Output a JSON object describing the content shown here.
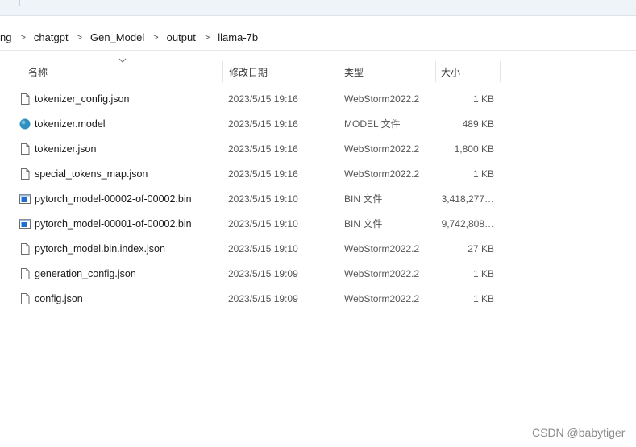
{
  "breadcrumb": [
    "ng",
    "chatgpt",
    "Gen_Model",
    "output",
    "llama-7b"
  ],
  "columns": {
    "name": "名称",
    "date": "修改日期",
    "type": "类型",
    "size": "大小"
  },
  "files": [
    {
      "name": "tokenizer_config.json",
      "date": "2023/5/15 19:16",
      "type": "WebStorm2022.2",
      "size": "1 KB",
      "icon": "json-file-icon"
    },
    {
      "name": "tokenizer.model",
      "date": "2023/5/15 19:16",
      "type": "MODEL 文件",
      "size": "489 KB",
      "icon": "model-file-icon"
    },
    {
      "name": "tokenizer.json",
      "date": "2023/5/15 19:16",
      "type": "WebStorm2022.2",
      "size": "1,800 KB",
      "icon": "json-file-icon"
    },
    {
      "name": "special_tokens_map.json",
      "date": "2023/5/15 19:16",
      "type": "WebStorm2022.2",
      "size": "1 KB",
      "icon": "json-file-icon"
    },
    {
      "name": "pytorch_model-00002-of-00002.bin",
      "date": "2023/5/15 19:10",
      "type": "BIN 文件",
      "size": "3,418,277…",
      "icon": "bin-file-icon"
    },
    {
      "name": "pytorch_model-00001-of-00002.bin",
      "date": "2023/5/15 19:10",
      "type": "BIN 文件",
      "size": "9,742,808…",
      "icon": "bin-file-icon"
    },
    {
      "name": "pytorch_model.bin.index.json",
      "date": "2023/5/15 19:10",
      "type": "WebStorm2022.2",
      "size": "27 KB",
      "icon": "json-file-icon"
    },
    {
      "name": "generation_config.json",
      "date": "2023/5/15 19:09",
      "type": "WebStorm2022.2",
      "size": "1 KB",
      "icon": "json-file-icon"
    },
    {
      "name": "config.json",
      "date": "2023/5/15 19:09",
      "type": "WebStorm2022.2",
      "size": "1 KB",
      "icon": "json-file-icon"
    }
  ],
  "watermark": "CSDN @babytiger",
  "colors": {
    "tabstrip": "#eff4f9",
    "model_icon": "#2f8fbf",
    "bin_icon": "#1e6fd0"
  }
}
